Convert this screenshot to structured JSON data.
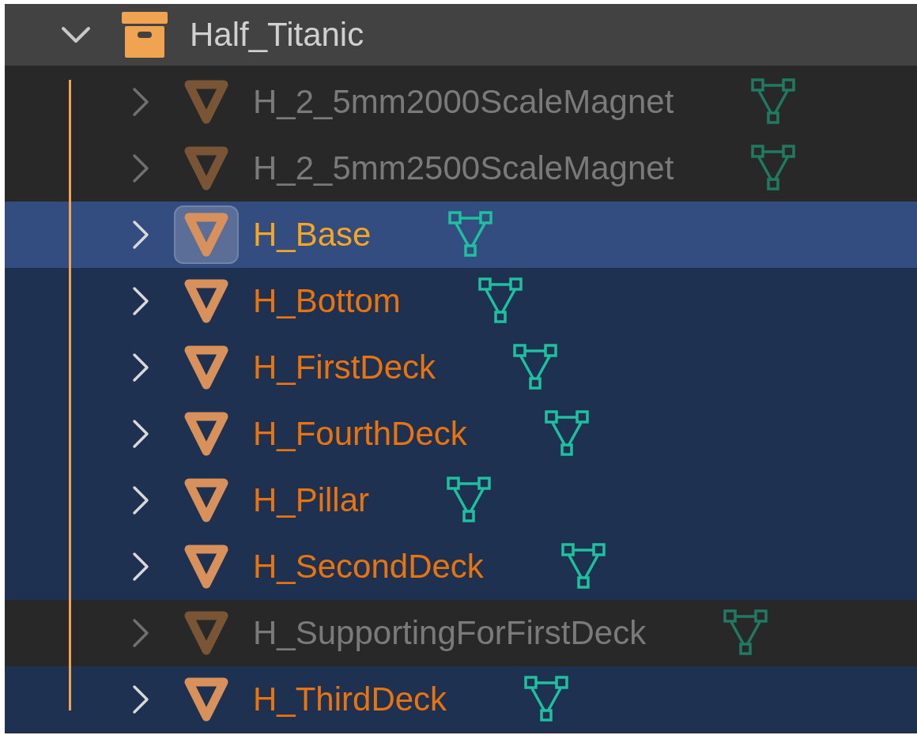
{
  "collection": {
    "name": "Half_Titanic",
    "expanded": true
  },
  "objects": [
    {
      "name": "H_2_5mm2000ScaleMagnet",
      "selected": false,
      "active": false
    },
    {
      "name": "H_2_5mm2500ScaleMagnet",
      "selected": false,
      "active": false
    },
    {
      "name": "H_Base",
      "selected": true,
      "active": true
    },
    {
      "name": "H_Bottom",
      "selected": true,
      "active": false
    },
    {
      "name": "H_FirstDeck",
      "selected": true,
      "active": false
    },
    {
      "name": "H_FourthDeck",
      "selected": true,
      "active": false
    },
    {
      "name": "H_Pillar",
      "selected": true,
      "active": false
    },
    {
      "name": "H_SecondDeck",
      "selected": true,
      "active": false
    },
    {
      "name": "H_SupportingForFirstDeck",
      "selected": false,
      "active": false
    },
    {
      "name": "H_ThirdDeck",
      "selected": true,
      "active": false
    }
  ]
}
